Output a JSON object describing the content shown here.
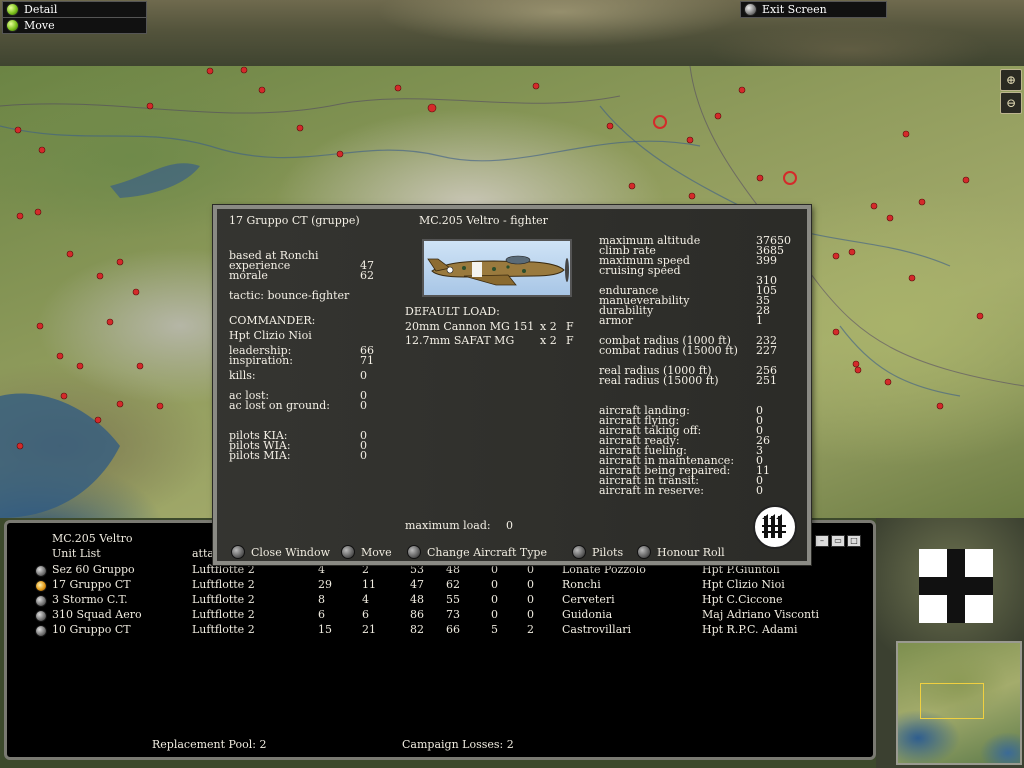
{
  "top_buttons": {
    "detail": "Detail",
    "move": "Move",
    "exit": "Exit Screen"
  },
  "dialog": {
    "unit_title": "17 Gruppo CT (gruppe)",
    "aircraft_title": "MC.205 Veltro - fighter",
    "left": {
      "based_at": "based at Ronchi",
      "experience_label": "experience",
      "experience_value": "47",
      "morale_label": "morale",
      "morale_value": "62",
      "tactic": "tactic: bounce-fighter",
      "commander_label": "COMMANDER:",
      "commander_name": "Hpt Clizio Nioi",
      "leadership_label": "leadership:",
      "leadership_value": "66",
      "inspiration_label": "inspiration:",
      "inspiration_value": "71",
      "kills_label": "kills:",
      "kills_value": "0",
      "ac_lost_label": "ac lost:",
      "ac_lost_value": "0",
      "ac_lost_ground_label": "ac lost on ground:",
      "ac_lost_ground_value": "0",
      "pilots_kia_label": "pilots KIA:",
      "pilots_kia_value": "0",
      "pilots_wia_label": "pilots WIA:",
      "pilots_wia_value": "0",
      "pilots_mia_label": "pilots MIA:",
      "pilots_mia_value": "0"
    },
    "load": {
      "header": "DEFAULT LOAD:",
      "weapons": [
        {
          "name": "20mm Cannon MG 151",
          "qty": "x 2",
          "arc": "F"
        },
        {
          "name": "12.7mm SAFAT MG",
          "qty": "x 2",
          "arc": "F"
        }
      ],
      "max_load_label": "maximum load:",
      "max_load_value": "0"
    },
    "stats": {
      "max_altitude_label": "maximum altitude",
      "max_altitude_value": "37650",
      "climb_rate_label": "climb rate",
      "climb_rate_value": "3685",
      "max_speed_label": "maximum speed",
      "max_speed_value": "399",
      "cruise_speed_label": "cruising speed",
      "cruise_speed_value": "310",
      "endurance_label": "endurance",
      "endurance_value": "105",
      "maneuver_label": "manueverability",
      "maneuver_value": "35",
      "durability_label": "durability",
      "durability_value": "28",
      "armor_label": "armor",
      "armor_value": "1",
      "combat_radius_1000_label": "combat radius (1000 ft)",
      "combat_radius_1000_value": "232",
      "combat_radius_15000_label": "combat radius (15000 ft)",
      "combat_radius_15000_value": "227",
      "real_radius_1000_label": "real radius (1000 ft)",
      "real_radius_1000_value": "256",
      "real_radius_15000_label": "real radius (15000 ft)",
      "real_radius_15000_value": "251",
      "landing_label": "aircraft landing:",
      "landing_value": "0",
      "flying_label": "aircraft flying:",
      "flying_value": "0",
      "taking_off_label": "aircraft taking off:",
      "taking_off_value": "0",
      "ready_label": "aircraft ready:",
      "ready_value": "26",
      "fueling_label": "aircraft fueling:",
      "fueling_value": "3",
      "maintenance_label": "aircraft in maintenance:",
      "maintenance_value": "0",
      "repaired_label": "aircraft being repaired:",
      "repaired_value": "11",
      "transit_label": "aircraft in transit:",
      "transit_value": "0",
      "reserve_label": "aircraft in reserve:",
      "reserve_value": "0"
    },
    "buttons": {
      "close": "Close Window",
      "move": "Move",
      "change_aircraft": "Change Aircraft Type",
      "pilots": "Pilots",
      "honour_roll": "Honour Roll"
    }
  },
  "panel": {
    "aircraft_name": "MC.205 Veltro",
    "list_title": "Unit List",
    "column_header_fragment": "atta",
    "rows": [
      {
        "name": "Sez 60 Gruppo",
        "hq": "Luftflotte 2",
        "c1": "4",
        "c2": "2",
        "c3": "53",
        "c4": "48",
        "c5": "0",
        "c6": "0",
        "base": "Lonate Pozzolo",
        "cmdr": "Hpt P.Giuntoli"
      },
      {
        "name": "17 Gruppo CT",
        "hq": "Luftflotte 2",
        "c1": "29",
        "c2": "11",
        "c3": "47",
        "c4": "62",
        "c5": "0",
        "c6": "0",
        "base": "Ronchi",
        "cmdr": "Hpt Clizio Nioi"
      },
      {
        "name": "3 Stormo C.T.",
        "hq": "Luftflotte 2",
        "c1": "8",
        "c2": "4",
        "c3": "48",
        "c4": "55",
        "c5": "0",
        "c6": "0",
        "base": "Cerveteri",
        "cmdr": "Hpt C.Ciccone"
      },
      {
        "name": "310 Squad Aero",
        "hq": "Luftflotte 2",
        "c1": "6",
        "c2": "6",
        "c3": "86",
        "c4": "73",
        "c5": "0",
        "c6": "0",
        "base": "Guidonia",
        "cmdr": "Maj Adriano Visconti"
      },
      {
        "name": "10 Gruppo CT",
        "hq": "Luftflotte 2",
        "c1": "15",
        "c2": "21",
        "c3": "82",
        "c4": "66",
        "c5": "5",
        "c6": "2",
        "base": "Castrovillari",
        "cmdr": "Hpt R.P.C. Adami"
      }
    ],
    "replacement_pool": "Replacement Pool: 2",
    "campaign_losses": "Campaign Losses: 2"
  },
  "colors": {
    "selected_row": "#e6c24a",
    "dialog_bg": "#2e2e2a",
    "panel_bg": "#000000"
  },
  "icons": {
    "zoom_in": "zoom-in-icon",
    "zoom_out": "zoom-out-icon",
    "nation": "balkenkreuz-icon",
    "unit_emblem": "fasces-emblem-icon"
  }
}
